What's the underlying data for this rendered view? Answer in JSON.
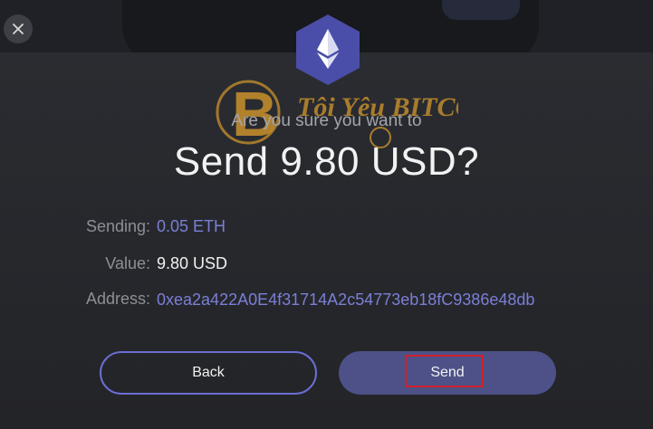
{
  "window": {
    "close_icon": "close-icon",
    "asset_icon": "ethereum-icon"
  },
  "confirm": {
    "prompt": "Are you sure you want to",
    "amount_heading": "Send 9.80 USD?"
  },
  "details": {
    "sending_label": "Sending:",
    "sending_value": "0.05 ETH",
    "value_label": "Value:",
    "value_value": "9.80 USD",
    "address_label": "Address:",
    "address_value": "0xea2a422A0E4f31714A2c54773eb18fC9386e48db"
  },
  "actions": {
    "back_label": "Back",
    "send_label": "Send"
  },
  "watermark": {
    "text": "Tôi Yêu BITCOIN"
  },
  "colors": {
    "accent": "#7b7fd6",
    "background": "#26282d",
    "send_button": "#4d5187",
    "highlight": "#d2202e",
    "watermark": "#c9912c"
  }
}
